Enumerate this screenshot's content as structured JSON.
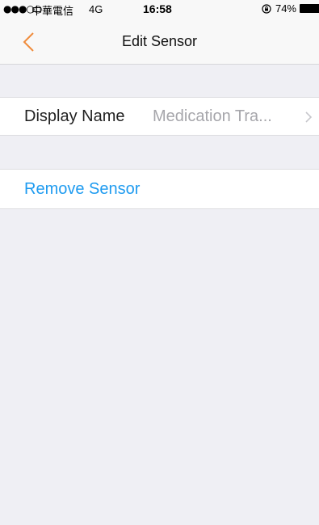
{
  "status_bar": {
    "signal": "●●●○○",
    "carrier": "中華電信",
    "network": "4G",
    "time": "16:58",
    "battery_percent": "74%",
    "icons": [
      "orientation-lock-icon",
      "battery-icon"
    ]
  },
  "nav": {
    "back_icon": "chevron-left-icon",
    "title": "Edit Sensor",
    "accent_color": "#f08c3c"
  },
  "settings": {
    "display_name_label": "Display Name",
    "display_name_value": "Medication Tra...",
    "display_name_icon": "chevron-right-icon",
    "remove_label": "Remove Sensor",
    "remove_color": "#1e9bf0"
  }
}
